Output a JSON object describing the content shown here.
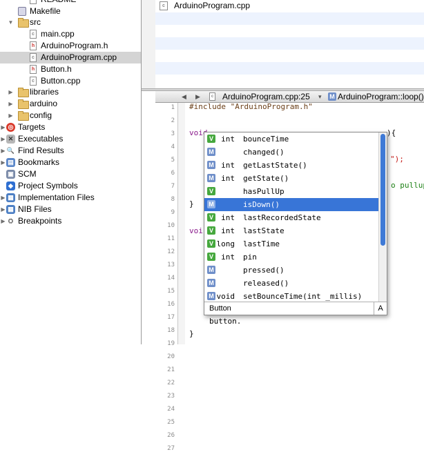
{
  "sidebar": {
    "items": [
      {
        "label": "README",
        "icon": "file-icon"
      },
      {
        "label": "Makefile",
        "icon": "makefile-icon"
      },
      {
        "label": "src",
        "icon": "folder-icon"
      },
      {
        "label": "main.cpp",
        "icon": "cpp-file-icon"
      },
      {
        "label": "ArduinoProgram.h",
        "icon": "header-file-icon"
      },
      {
        "label": "ArduinoProgram.cpp",
        "icon": "cpp-file-icon"
      },
      {
        "label": "Button.h",
        "icon": "header-file-icon"
      },
      {
        "label": "Button.cpp",
        "icon": "cpp-file-icon"
      },
      {
        "label": "libraries",
        "icon": "folder-icon"
      },
      {
        "label": "arduino",
        "icon": "folder-icon"
      },
      {
        "label": "config",
        "icon": "folder-icon"
      },
      {
        "label": "Targets",
        "icon": "targets-icon"
      },
      {
        "label": "Executables",
        "icon": "executables-icon"
      },
      {
        "label": "Find Results",
        "icon": "find-icon"
      },
      {
        "label": "Bookmarks",
        "icon": "bookmarks-icon"
      },
      {
        "label": "SCM",
        "icon": "scm-icon"
      },
      {
        "label": "Project Symbols",
        "icon": "symbols-icon"
      },
      {
        "label": "Implementation Files",
        "icon": "implementation-icon"
      },
      {
        "label": "NIB Files",
        "icon": "nib-icon"
      },
      {
        "label": "Breakpoints",
        "icon": "breakpoints-icon"
      }
    ]
  },
  "file_list": {
    "current_file": "ArduinoProgram.cpp"
  },
  "navbar": {
    "file_location": "ArduinoProgram.cpp:25",
    "symbol": "ArduinoProgram::loop()"
  },
  "editor": {
    "line_numbers": [
      "1",
      "2",
      "3",
      "4",
      "5",
      "6",
      "7",
      "8",
      "9",
      "10",
      "11",
      "12",
      "13",
      "14",
      "15",
      "16",
      "17",
      "18",
      "19",
      "20",
      "21",
      "22",
      "23",
      "24",
      "25",
      "26",
      "27"
    ],
    "lines": {
      "l1": "#include \"ArduinoProgram.h\"",
      "l4a": "void",
      "l4b": "){",
      "l6": "\");",
      "l7": "o pullup",
      "l10": "}",
      "l12a": "voi",
      "l22": "button.",
      "l23": "}"
    }
  },
  "completion": {
    "items": [
      {
        "kind": "V",
        "type": "int",
        "name": "bounceTime"
      },
      {
        "kind": "M",
        "type": "",
        "name": "changed()"
      },
      {
        "kind": "M",
        "type": "int",
        "name": "getLastState()"
      },
      {
        "kind": "M",
        "type": "int",
        "name": "getState()"
      },
      {
        "kind": "V",
        "type": "",
        "name": "hasPullUp"
      },
      {
        "kind": "M",
        "type": "",
        "name": "isDown()"
      },
      {
        "kind": "V",
        "type": "int",
        "name": "lastRecordedState"
      },
      {
        "kind": "V",
        "type": "int",
        "name": "lastState"
      },
      {
        "kind": "V",
        "type": "long",
        "name": "lastTime"
      },
      {
        "kind": "V",
        "type": "int",
        "name": "pin"
      },
      {
        "kind": "M",
        "type": "",
        "name": "pressed()"
      },
      {
        "kind": "M",
        "type": "",
        "name": "released()"
      },
      {
        "kind": "M",
        "type": "void",
        "name": "setBounceTime(int _millis)"
      }
    ],
    "selected_index": 5,
    "prefix": "Button",
    "sort_button": "A"
  },
  "colors": {
    "selection": "#3875d7",
    "variable_badge": "#46a83e",
    "method_badge": "#6e8ec9"
  }
}
